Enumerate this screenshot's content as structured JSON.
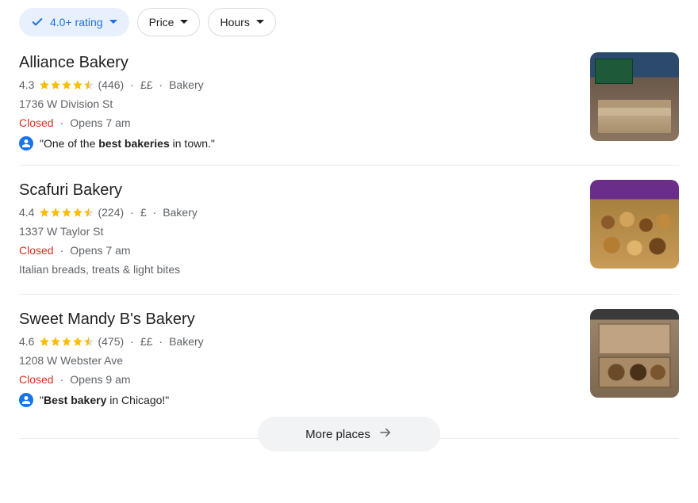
{
  "filters": {
    "rating": {
      "label": "4.0+ rating",
      "active": true
    },
    "price": {
      "label": "Price",
      "active": false
    },
    "hours": {
      "label": "Hours",
      "active": false
    }
  },
  "results": [
    {
      "name": "Alliance Bakery",
      "rating": "4.3",
      "stars": 4.5,
      "reviews": "(446)",
      "price": "££",
      "category": "Bakery",
      "address": "1736 W Division St",
      "status": "Closed",
      "opens": "Opens 7 am",
      "quote_prefix": "\"One of the ",
      "quote_bold": "best bakeries",
      "quote_suffix": " in town.\"",
      "has_quote": true,
      "thumb_class": "alliance"
    },
    {
      "name": "Scafuri Bakery",
      "rating": "4.4",
      "stars": 4.5,
      "reviews": "(224)",
      "price": "£",
      "category": "Bakery",
      "address": "1337 W Taylor St",
      "status": "Closed",
      "opens": "Opens 7 am",
      "tagline": "Italian breads, treats & light bites",
      "has_quote": false,
      "thumb_class": "scafuri"
    },
    {
      "name": "Sweet Mandy B's Bakery",
      "rating": "4.6",
      "stars": 4.5,
      "reviews": "(475)",
      "price": "££",
      "category": "Bakery",
      "address": "1208 W Webster Ave",
      "status": "Closed",
      "opens": "Opens 9 am",
      "quote_prefix": "\"",
      "quote_bold": "Best bakery",
      "quote_suffix": " in Chicago!\"",
      "has_quote": true,
      "thumb_class": "mandy"
    }
  ],
  "more_label": "More places"
}
